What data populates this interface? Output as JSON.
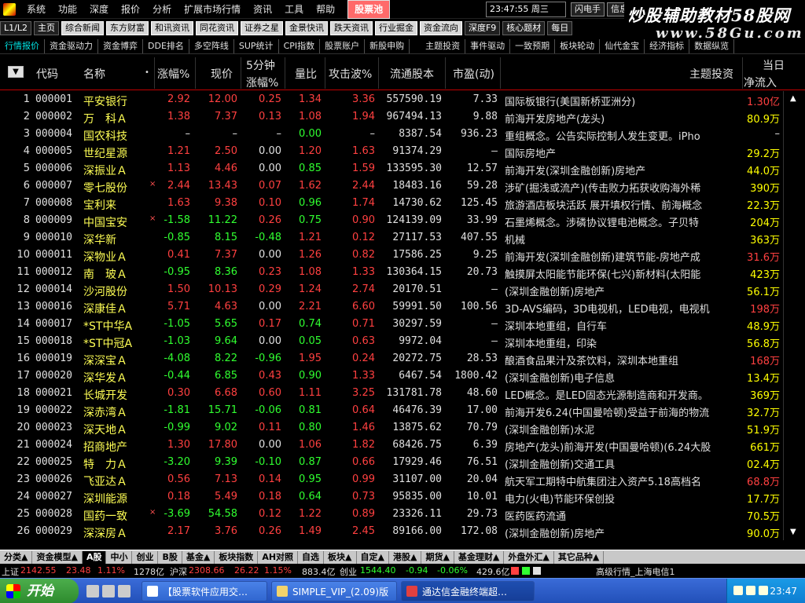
{
  "menu": {
    "items": [
      "系统",
      "功能",
      "深度",
      "报价",
      "分析",
      "扩展市场行情",
      "资讯",
      "工具",
      "帮助"
    ],
    "pool": "股票池",
    "clock": "23:47:55 周三",
    "right_btns": [
      "闪电手",
      "信息",
      "行"
    ]
  },
  "brand": {
    "line1": "炒股辅助教材58股网",
    "line2": "www.58Gu.com"
  },
  "toolbar": [
    "L1/L2",
    "主页",
    "综合新闻",
    "东方财富",
    "和讯资讯",
    "同花资讯",
    "证券之星",
    "金景快讯",
    "跌天资讯",
    "行业掘金",
    "资金流向",
    "深度F9",
    "核心题材",
    "每日"
  ],
  "toolbar2": [
    "行情报价",
    "资金驱动力",
    "资金博弈",
    "DDE排名",
    "多空阵线",
    "SUP统计",
    "CPI指数",
    "股票账户",
    "新股申购",
    "主题投资",
    "事件驱动",
    "一致预期",
    "板块轮动",
    "仙代金宝",
    "经济指标",
    "数据纵览"
  ],
  "header": {
    "sort": "▼",
    "code": "代码",
    "name": "名称",
    "pct": "涨幅%",
    "price": "现价",
    "m5a": "5分钟",
    "m5b": "涨幅%",
    "vr": "量比",
    "atk": "攻击波%",
    "float": "流通股本",
    "pe": "市盈(动)",
    "theme": "主题投资",
    "flow_a": "当日",
    "flow_b": "净流入"
  },
  "rows": [
    {
      "i": "1",
      "code": "000001",
      "name": "平安银行",
      "dot": "",
      "pct": "2.92",
      "price": "12.00",
      "m5": "0.25",
      "vr": "1.34",
      "atk": "3.36",
      "float": "557590.19",
      "pe": "7.33",
      "theme": "国际板银行(美国新桥亚洲分)",
      "flow": "1.30亿",
      "pc": "up",
      "prc": "up",
      "m5c": "up",
      "vrc": "up",
      "atkc": "up",
      "fc": "flowup"
    },
    {
      "i": "2",
      "code": "000002",
      "name": "万　科Ａ",
      "dot": "",
      "pct": "1.38",
      "price": "7.37",
      "m5": "0.13",
      "vr": "1.08",
      "atk": "1.94",
      "float": "967494.13",
      "pe": "9.88",
      "theme": "前海开发房地产(龙头)",
      "flow": "80.9万",
      "pc": "up",
      "prc": "up",
      "m5c": "up",
      "vrc": "up",
      "atkc": "up",
      "fc": "flowdown"
    },
    {
      "i": "3",
      "code": "000004",
      "name": "国农科技",
      "dot": "",
      "pct": "–",
      "price": "–",
      "m5": "–",
      "vr": "0.00",
      "atk": "–",
      "float": "8387.54",
      "pe": "936.23",
      "theme": "重组概念。公告实际控制人发生变更。iPho",
      "flow": "–",
      "pc": "flat",
      "prc": "flat",
      "m5c": "flat",
      "vrc": "down",
      "atkc": "flat",
      "fc": "flat"
    },
    {
      "i": "4",
      "code": "000005",
      "name": "世纪星源",
      "dot": "",
      "pct": "1.21",
      "price": "2.50",
      "m5": "0.00",
      "vr": "1.20",
      "atk": "1.63",
      "float": "91374.29",
      "pe": "–",
      "theme": "国际房地产",
      "flow": "29.2万",
      "pc": "up",
      "prc": "up",
      "m5c": "flat",
      "vrc": "up",
      "atkc": "up",
      "fc": "flowdown"
    },
    {
      "i": "5",
      "code": "000006",
      "name": "深振业Ａ",
      "dot": "",
      "pct": "1.13",
      "price": "4.46",
      "m5": "0.00",
      "vr": "0.85",
      "atk": "1.59",
      "float": "133595.30",
      "pe": "12.57",
      "theme": "前海开发(深圳金融创新)房地产",
      "flow": "44.0万",
      "pc": "up",
      "prc": "up",
      "m5c": "flat",
      "vrc": "down",
      "atkc": "up",
      "fc": "flowdown"
    },
    {
      "i": "6",
      "code": "000007",
      "name": "零七股份",
      "dot": "×",
      "pct": "2.44",
      "price": "13.43",
      "m5": "0.07",
      "vr": "1.62",
      "atk": "2.44",
      "float": "18483.16",
      "pe": "59.28",
      "theme": "涉矿(掘浅或流产)(传击败力拓获收购海外稀",
      "flow": "390万",
      "pc": "up",
      "prc": "up",
      "m5c": "up",
      "vrc": "up",
      "atkc": "up",
      "fc": "flowdown"
    },
    {
      "i": "7",
      "code": "000008",
      "name": "宝利来",
      "dot": "",
      "pct": "1.63",
      "price": "9.38",
      "m5": "0.10",
      "vr": "0.96",
      "atk": "1.74",
      "float": "14730.62",
      "pe": "125.45",
      "theme": "旅游酒店板块活跃 展开填权行情、前海概念",
      "flow": "22.3万",
      "pc": "up",
      "prc": "up",
      "m5c": "up",
      "vrc": "down",
      "atkc": "up",
      "fc": "flowdown"
    },
    {
      "i": "8",
      "code": "000009",
      "name": "中国宝安",
      "dot": "×",
      "pct": "-1.58",
      "price": "11.22",
      "m5": "0.26",
      "vr": "0.75",
      "atk": "0.90",
      "float": "124139.09",
      "pe": "33.99",
      "theme": "石墨烯概念。涉磷协议锂电池概念。子贝特",
      "flow": "204万",
      "pc": "down",
      "prc": "down",
      "m5c": "up",
      "vrc": "down",
      "atkc": "up",
      "fc": "flowdown"
    },
    {
      "i": "9",
      "code": "000010",
      "name": "深华新",
      "dot": "",
      "pct": "-0.85",
      "price": "8.15",
      "m5": "-0.48",
      "vr": "1.21",
      "atk": "0.12",
      "float": "27117.53",
      "pe": "407.55",
      "theme": "机械",
      "flow": "363万",
      "pc": "down",
      "prc": "down",
      "m5c": "down",
      "vrc": "up",
      "atkc": "up",
      "fc": "flowdown"
    },
    {
      "i": "10",
      "code": "000011",
      "name": "深物业Ａ",
      "dot": "",
      "pct": "0.41",
      "price": "7.37",
      "m5": "0.00",
      "vr": "1.26",
      "atk": "0.82",
      "float": "17586.25",
      "pe": "9.25",
      "theme": "前海开发(深圳金融创新)建筑节能-房地产成",
      "flow": "31.6万",
      "pc": "up",
      "prc": "up",
      "m5c": "flat",
      "vrc": "up",
      "atkc": "up",
      "fc": "flowup"
    },
    {
      "i": "11",
      "code": "000012",
      "name": "南　玻Ａ",
      "dot": "",
      "pct": "-0.95",
      "price": "8.36",
      "m5": "0.23",
      "vr": "1.08",
      "atk": "1.33",
      "float": "130364.15",
      "pe": "20.73",
      "theme": "触摸屏太阳能节能环保(七兴)新材料(太阳能",
      "flow": "423万",
      "pc": "down",
      "prc": "down",
      "m5c": "up",
      "vrc": "up",
      "atkc": "up",
      "fc": "flowdown"
    },
    {
      "i": "12",
      "code": "000014",
      "name": "沙河股份",
      "dot": "",
      "pct": "1.50",
      "price": "10.13",
      "m5": "0.29",
      "vr": "1.24",
      "atk": "2.74",
      "float": "20170.51",
      "pe": "–",
      "theme": "(深圳金融创新)房地产",
      "flow": "56.1万",
      "pc": "up",
      "prc": "up",
      "m5c": "up",
      "vrc": "up",
      "atkc": "up",
      "fc": "flowdown"
    },
    {
      "i": "13",
      "code": "000016",
      "name": "深康佳Ａ",
      "dot": "",
      "pct": "5.71",
      "price": "4.63",
      "m5": "0.00",
      "vr": "2.21",
      "atk": "6.60",
      "float": "59991.50",
      "pe": "100.56",
      "theme": "3D-AVS编码，3D电视机，LED电视，电视机",
      "flow": "198万",
      "pc": "up",
      "prc": "up",
      "m5c": "flat",
      "vrc": "up",
      "atkc": "up",
      "fc": "flowup"
    },
    {
      "i": "14",
      "code": "000017",
      "name": "*ST中华A",
      "dot": "",
      "pct": "-1.05",
      "price": "5.65",
      "m5": "0.17",
      "vr": "0.74",
      "atk": "0.71",
      "float": "30297.59",
      "pe": "–",
      "theme": "深圳本地重组，自行车",
      "flow": "48.9万",
      "pc": "down",
      "prc": "down",
      "m5c": "up",
      "vrc": "down",
      "atkc": "up",
      "fc": "flowdown"
    },
    {
      "i": "15",
      "code": "000018",
      "name": "*ST中冠A",
      "dot": "",
      "pct": "-1.03",
      "price": "9.64",
      "m5": "0.00",
      "vr": "0.05",
      "atk": "0.63",
      "float": "9972.04",
      "pe": "–",
      "theme": "深圳本地重组，印染",
      "flow": "56.8万",
      "pc": "down",
      "prc": "down",
      "m5c": "flat",
      "vrc": "down",
      "atkc": "up",
      "fc": "flowdown"
    },
    {
      "i": "16",
      "code": "000019",
      "name": "深深宝Ａ",
      "dot": "",
      "pct": "-4.08",
      "price": "8.22",
      "m5": "-0.96",
      "vr": "1.95",
      "atk": "0.24",
      "float": "20272.75",
      "pe": "28.53",
      "theme": "酿酒食品果汁及茶饮料，深圳本地重组",
      "flow": "168万",
      "pc": "down",
      "prc": "down",
      "m5c": "down",
      "vrc": "up",
      "atkc": "up",
      "fc": "flowup"
    },
    {
      "i": "17",
      "code": "000020",
      "name": "深华发Ａ",
      "dot": "",
      "pct": "-0.44",
      "price": "6.85",
      "m5": "0.43",
      "vr": "0.90",
      "atk": "1.33",
      "float": "6467.54",
      "pe": "1800.42",
      "theme": "(深圳金融创新)电子信息",
      "flow": "13.4万",
      "pc": "down",
      "prc": "down",
      "m5c": "up",
      "vrc": "down",
      "atkc": "up",
      "fc": "flowdown"
    },
    {
      "i": "18",
      "code": "000021",
      "name": "长城开发",
      "dot": "",
      "pct": "0.30",
      "price": "6.68",
      "m5": "0.60",
      "vr": "1.11",
      "atk": "3.25",
      "float": "131781.78",
      "pe": "48.60",
      "theme": "LED概念。是LED固态光源制造商和开发商。",
      "flow": "369万",
      "pc": "up",
      "prc": "up",
      "m5c": "up",
      "vrc": "up",
      "atkc": "up",
      "fc": "flowdown"
    },
    {
      "i": "19",
      "code": "000022",
      "name": "深赤湾Ａ",
      "dot": "",
      "pct": "-1.81",
      "price": "15.71",
      "m5": "-0.06",
      "vr": "0.81",
      "atk": "0.64",
      "float": "46476.39",
      "pe": "17.00",
      "theme": "前海开发6.24(中国曼哈顿)受益于前海的物流",
      "flow": "32.7万",
      "pc": "down",
      "prc": "down",
      "m5c": "down",
      "vrc": "down",
      "atkc": "up",
      "fc": "flowdown"
    },
    {
      "i": "20",
      "code": "000023",
      "name": "深天地Ａ",
      "dot": "",
      "pct": "-0.99",
      "price": "9.02",
      "m5": "0.11",
      "vr": "0.80",
      "atk": "1.46",
      "float": "13875.62",
      "pe": "70.79",
      "theme": "(深圳金融创新)水泥",
      "flow": "51.9万",
      "pc": "down",
      "prc": "down",
      "m5c": "up",
      "vrc": "down",
      "atkc": "up",
      "fc": "flowdown"
    },
    {
      "i": "21",
      "code": "000024",
      "name": "招商地产",
      "dot": "",
      "pct": "1.30",
      "price": "17.80",
      "m5": "0.00",
      "vr": "1.06",
      "atk": "1.82",
      "float": "68426.75",
      "pe": "6.39",
      "theme": "房地产(龙头)前海开发(中国曼哈顿)(6.24大股",
      "flow": "661万",
      "pc": "up",
      "prc": "up",
      "m5c": "flat",
      "vrc": "up",
      "atkc": "up",
      "fc": "flowdown"
    },
    {
      "i": "22",
      "code": "000025",
      "name": "特　力Ａ",
      "dot": "",
      "pct": "-3.20",
      "price": "9.39",
      "m5": "-0.10",
      "vr": "0.87",
      "atk": "0.66",
      "float": "17929.46",
      "pe": "76.51",
      "theme": "(深圳金融创新)交通工具",
      "flow": "02.4万",
      "pc": "down",
      "prc": "down",
      "m5c": "down",
      "vrc": "down",
      "atkc": "up",
      "fc": "flowdown"
    },
    {
      "i": "23",
      "code": "000026",
      "name": "飞亚达Ａ",
      "dot": "",
      "pct": "0.56",
      "price": "7.13",
      "m5": "0.14",
      "vr": "0.95",
      "atk": "0.99",
      "float": "31107.00",
      "pe": "20.04",
      "theme": "航天军工期特中航集团注入资产5.18高档名",
      "flow": "68.8万",
      "pc": "up",
      "prc": "up",
      "m5c": "up",
      "vrc": "down",
      "atkc": "up",
      "fc": "flowup"
    },
    {
      "i": "24",
      "code": "000027",
      "name": "深圳能源",
      "dot": "",
      "pct": "0.18",
      "price": "5.49",
      "m5": "0.18",
      "vr": "0.64",
      "atk": "0.73",
      "float": "95835.00",
      "pe": "10.01",
      "theme": "电力(火电)节能环保创投",
      "flow": "17.7万",
      "pc": "up",
      "prc": "up",
      "m5c": "up",
      "vrc": "down",
      "atkc": "up",
      "fc": "flowdown"
    },
    {
      "i": "25",
      "code": "000028",
      "name": "国药一致",
      "dot": "×",
      "pct": "-3.69",
      "price": "54.58",
      "m5": "0.12",
      "vr": "1.22",
      "atk": "0.89",
      "float": "23326.11",
      "pe": "29.73",
      "theme": "医药医药流通",
      "flow": "70.5万",
      "pc": "down",
      "prc": "down",
      "m5c": "up",
      "vrc": "up",
      "atkc": "up",
      "fc": "flowdown"
    },
    {
      "i": "26",
      "code": "000029",
      "name": "深深房Ａ",
      "dot": "",
      "pct": "2.17",
      "price": "3.76",
      "m5": "0.26",
      "vr": "1.49",
      "atk": "2.45",
      "float": "89166.00",
      "pe": "172.08",
      "theme": "(深圳金融创新)房地产",
      "flow": "90.0万",
      "pc": "up",
      "prc": "up",
      "m5c": "up",
      "vrc": "up",
      "atkc": "up",
      "fc": "flowdown"
    }
  ],
  "tabs": [
    "分类▲",
    "资金模型▲",
    "A股",
    "中小",
    "创业",
    "B股",
    "基金▲",
    "板块指数",
    "AH对照",
    "自选",
    "板块▲",
    "自定▲",
    "港股▲",
    "期货▲",
    "基金理财▲",
    "外盘外汇▲",
    "其它品种▲"
  ],
  "indexbar": {
    "sh_label": "上证",
    "sh_val": "2142.55",
    "sh_chg": "23.48",
    "sh_pct": "1.11%",
    "sh_amt": "1278亿",
    "hs_label": "沪深",
    "hs_val": "2308.66",
    "hs_chg": "26.22",
    "hs_pct": "1.15%",
    "hs_amt": "883.4亿",
    "cy_label": "创业",
    "cy_val": "1544.40",
    "cy_chg": "-0.94",
    "cy_pct": "-0.06%",
    "cy_amt": "429.6亿",
    "server": "高级行情_上海电信1"
  },
  "taskbar": {
    "start": "开始",
    "tasks": [
      "【股票软件应用交…",
      "SIMPLE_VIP_(2.09)版",
      "通达信金融终端超…"
    ],
    "time": "23:47"
  }
}
